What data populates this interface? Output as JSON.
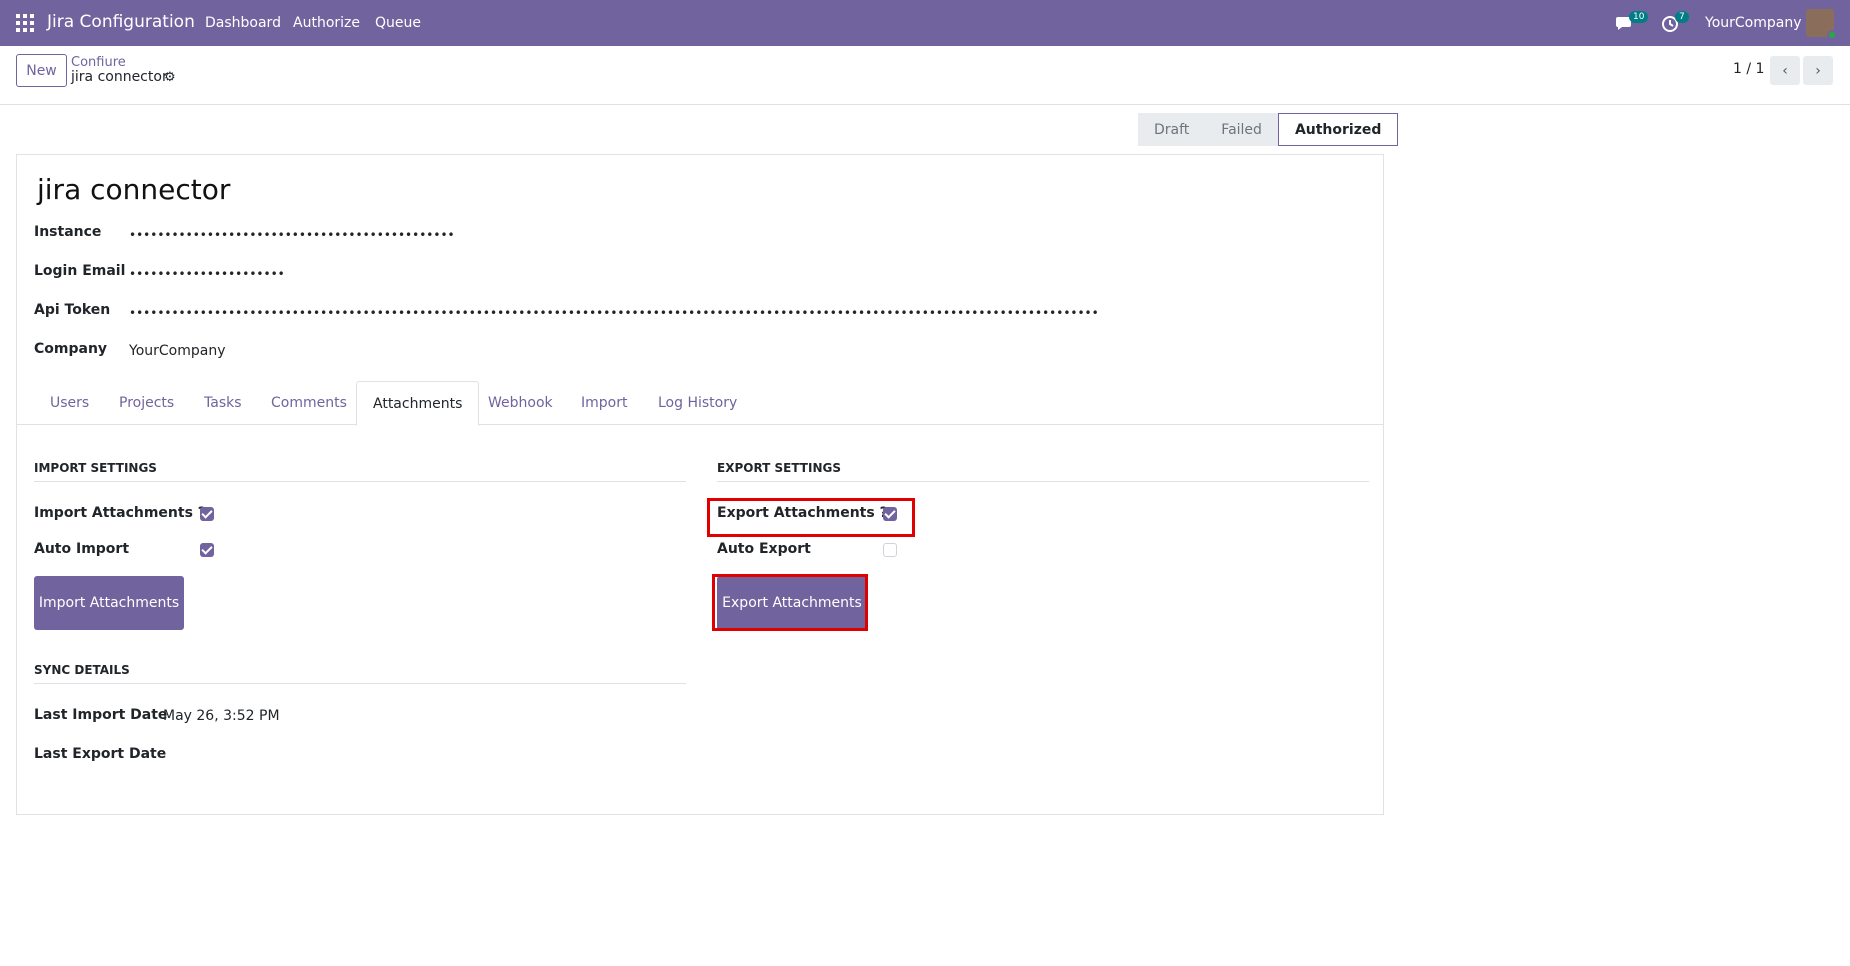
{
  "topbar": {
    "app_name": "Jira Configuration",
    "nav": [
      "Dashboard",
      "Authorize",
      "Queue"
    ],
    "messages_count": "10",
    "activities_count": "7",
    "company": "YourCompany"
  },
  "control": {
    "new_label": "New",
    "breadcrumb_parent": "Confiure",
    "breadcrumb_current": "jira connector",
    "pager": "1 / 1"
  },
  "status": {
    "stages": [
      "Draft",
      "Failed",
      "Authorized"
    ],
    "active": "Authorized"
  },
  "form": {
    "title": "jira connector",
    "fields": {
      "instance_label": "Instance",
      "instance_value": "••••••••••••••••••••••••••••••••••••••••••••••",
      "email_label": "Login Email",
      "email_value": "••••••••••••••••••••••",
      "token_label": "Api Token",
      "token_value": "••••••••••••••••••••••••••••••••••••••••••••••••••••••••••••••••••••••••••••••••••••••••••••••••••••••••••••••••••••••••••••••••••••••••••••••••••••••••••••••••••••••••••••••••••••••••••••••••",
      "company_label": "Company",
      "company_value": "YourCompany"
    },
    "tabs": [
      "Users",
      "Projects",
      "Tasks",
      "Comments",
      "Attachments",
      "Webhook",
      "Import",
      "Log History"
    ],
    "active_tab": "Attachments"
  },
  "attachments": {
    "import_title": "IMPORT SETTINGS",
    "import_attachments_label": "Import Attachments ?",
    "import_attachments_checked": true,
    "auto_import_label": "Auto Import",
    "auto_import_checked": true,
    "import_button": "Import Attachments",
    "export_title": "EXPORT SETTINGS",
    "export_attachments_label": "Export Attachments ?",
    "export_attachments_checked": true,
    "auto_export_label": "Auto Export",
    "auto_export_checked": false,
    "export_button": "Export Attachments",
    "sync_title": "SYNC DETAILS",
    "last_import_label": "Last Import Date",
    "last_import_value": "May 26, 3:52 PM",
    "last_export_label": "Last Export Date"
  },
  "colors": {
    "brand": "#71639e",
    "highlight": "#e00000"
  }
}
